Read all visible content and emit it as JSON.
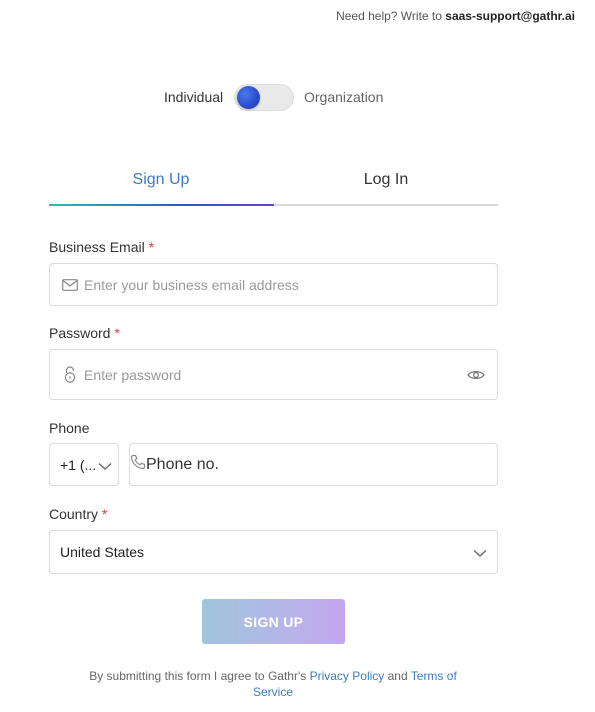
{
  "help": {
    "prefix": "Need help? Write to ",
    "email": "saas-support@gathr.ai"
  },
  "account_type": {
    "left_label": "Individual",
    "right_label": "Organization",
    "selected": "Individual"
  },
  "tabs": [
    {
      "label": "Sign Up",
      "active": true
    },
    {
      "label": "Log In",
      "active": false
    }
  ],
  "form": {
    "email": {
      "label": "Business Email",
      "required_mark": "*",
      "placeholder": "Enter your business email address",
      "icon": "envelope-icon"
    },
    "password": {
      "label": "Password",
      "required_mark": "*",
      "placeholder": "Enter password",
      "icon": "lock-icon"
    },
    "phone": {
      "label": "Phone",
      "country_code": "+1 (...",
      "placeholder": "Phone no.",
      "icon": "phone-icon"
    },
    "country": {
      "label": "Country",
      "required_mark": "*",
      "value": "United States"
    }
  },
  "submit_label": "SIGN UP",
  "legal": {
    "text1": "By submitting this form I agree to Gathr's ",
    "privacy": "Privacy Policy",
    "and": " and ",
    "terms": "Terms of Service"
  },
  "colors": {
    "accent": "#3b7cc5",
    "required": "#e53935",
    "toggle_knob": "#2b4fd0"
  }
}
